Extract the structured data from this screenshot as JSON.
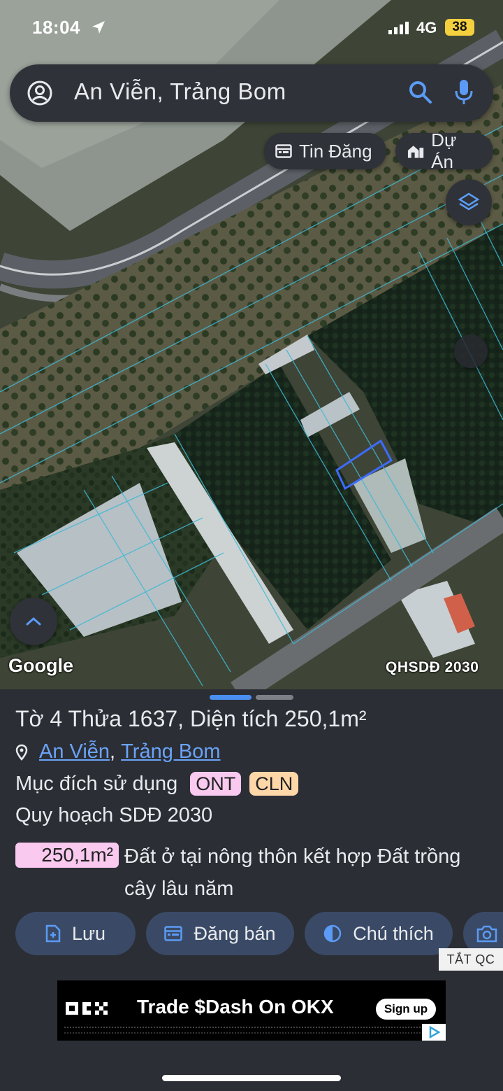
{
  "status_bar": {
    "time": "18:04",
    "network": "4G",
    "battery": "38"
  },
  "search": {
    "query": "An Viễn, Trảng Bom",
    "icons": [
      "account-icon",
      "search-icon",
      "mic-icon"
    ]
  },
  "chips": {
    "listings": "Tin Đăng",
    "projects": "Dự Án"
  },
  "map": {
    "attribution": "Google",
    "overlay_label": "QHSDĐ 2030"
  },
  "parcel": {
    "title_prefix": "Tờ 4 Thửa",
    "parcel_number": "1637",
    "area_label": ", Diện tích",
    "area_value": "250,1m²",
    "location": {
      "ward": "An Viễn",
      "separator": ",",
      "district": "Trảng Bom"
    },
    "purpose_label": "Mục đích sử dụng",
    "purpose_codes": [
      "ONT",
      "CLN"
    ],
    "planning_label": "Quy hoạch SDĐ 2030",
    "planning_area": "250,1m²",
    "planning_description": "Đất ở tại nông thôn kết hợp Đất trồng cây lâu năm"
  },
  "actions": {
    "save": "Lưu",
    "post_sale": "Đăng bán",
    "legend": "Chú thích"
  },
  "ad": {
    "close_label": "TẮT QC",
    "headline": "Trade $Dash On OKX",
    "cta": "Sign up"
  },
  "colors": {
    "sheet_bg": "#2b2e35",
    "button_bg": "#3a4a66",
    "link": "#6aa3f7",
    "tag_ont": "#f9c9ef",
    "tag_cln": "#fdd7a8",
    "accent": "#4a8ef0"
  }
}
